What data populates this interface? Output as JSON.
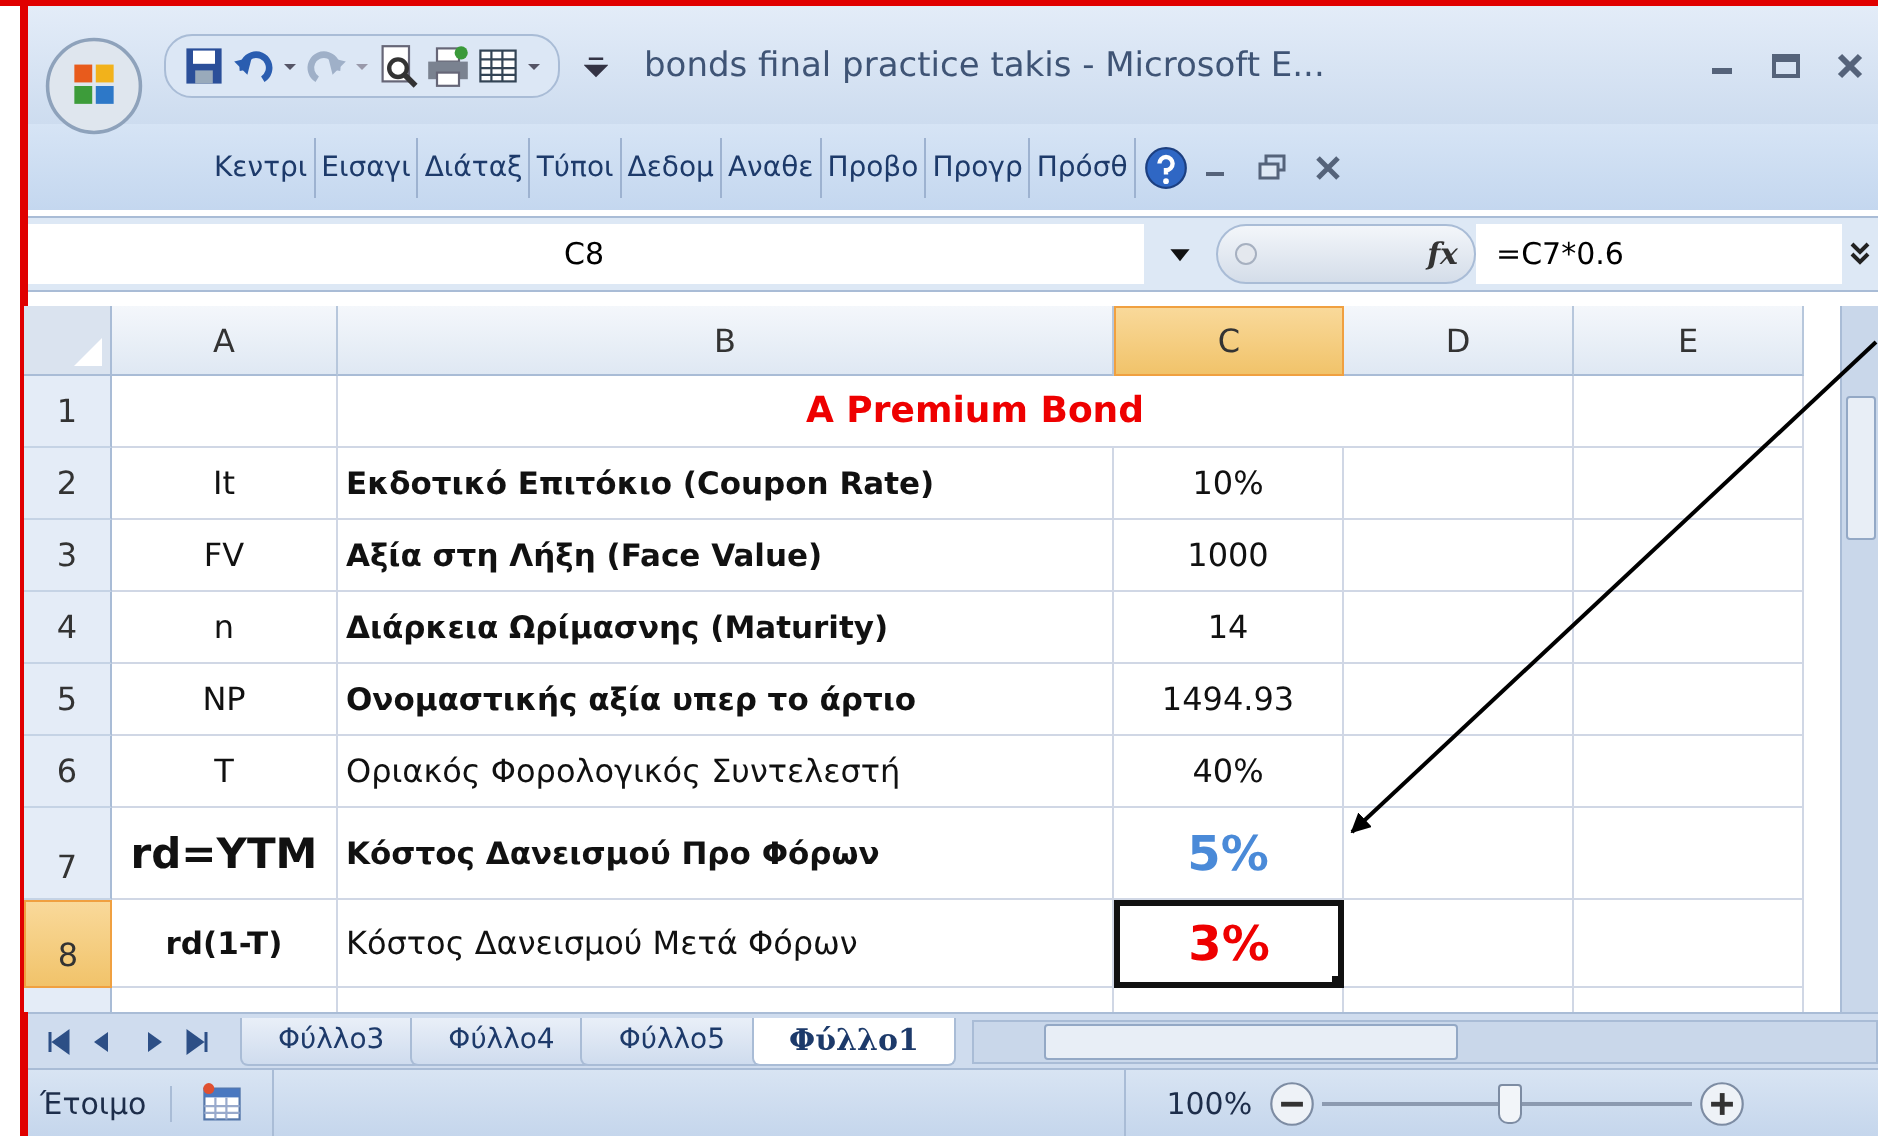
{
  "window": {
    "title": "bonds final practice takis - Microsoft E..."
  },
  "ribbon_tabs": [
    {
      "label": "Κεντρι",
      "selected": false
    },
    {
      "label": "Εισαγι",
      "selected": false
    },
    {
      "label": "Διάταξ",
      "selected": false
    },
    {
      "label": "Τύποι",
      "selected": false
    },
    {
      "label": "Δεδομ",
      "selected": false
    },
    {
      "label": "Αναθε",
      "selected": false
    },
    {
      "label": "Προβο",
      "selected": false
    },
    {
      "label": "Προγρ",
      "selected": false
    },
    {
      "label": "Πρόσθ",
      "selected": false
    }
  ],
  "formula_bar": {
    "name_box": "C8",
    "fx": "fx",
    "formula": "=C7*0.6"
  },
  "columns": [
    {
      "label": "A",
      "selected": false
    },
    {
      "label": "B",
      "selected": false
    },
    {
      "label": "C",
      "selected": true
    },
    {
      "label": "D",
      "selected": false
    },
    {
      "label": "E",
      "selected": false
    }
  ],
  "rows": [
    {
      "number": "1",
      "selected": false,
      "kind": "title",
      "title": "A Premium Bond"
    },
    {
      "number": "2",
      "selected": false,
      "kind": "data",
      "a": {
        "text": "It",
        "kind": "plain"
      },
      "b": {
        "text": "Εκδοτικό Επιτόκιο (Coupon Rate)",
        "kind": "bold"
      },
      "c": {
        "text": "10%",
        "kind": "plain",
        "active": false
      }
    },
    {
      "number": "3",
      "selected": false,
      "kind": "data",
      "a": {
        "text": "FV",
        "kind": "plain"
      },
      "b": {
        "text": " Αξία στη Λήξη (Face Value)",
        "kind": "bold"
      },
      "c": {
        "text": "1000",
        "kind": "plain",
        "active": false
      }
    },
    {
      "number": "4",
      "selected": false,
      "kind": "data",
      "a": {
        "text": "n",
        "kind": "plain"
      },
      "b": {
        "text": "Διάρκεια Ωρίμασνης (Maturity)",
        "kind": "bold"
      },
      "c": {
        "text": "14",
        "kind": "plain",
        "active": false
      }
    },
    {
      "number": "5",
      "selected": false,
      "kind": "data",
      "a": {
        "text": "NP",
        "kind": "plain"
      },
      "b": {
        "text": "Ονομαστικής αξία υπερ το άρτιο",
        "kind": "bold"
      },
      "c": {
        "text": "1494.93",
        "kind": "plain",
        "active": false
      }
    },
    {
      "number": "6",
      "selected": false,
      "kind": "data",
      "a": {
        "text": "T",
        "kind": "plain"
      },
      "b": {
        "text": "Οριακός Φορολογικός Συντελεστή",
        "kind": "plain"
      },
      "c": {
        "text": "40%",
        "kind": "plain",
        "active": false
      }
    },
    {
      "number": "7",
      "selected": false,
      "kind": "data",
      "a": {
        "text": "rd=YTM",
        "kind": "big"
      },
      "b": {
        "text": "Κόστος Δανεισμού Προ Φόρων",
        "kind": "bold"
      },
      "c": {
        "text": "5%",
        "kind": "blue",
        "active": false
      }
    },
    {
      "number": "8",
      "selected": true,
      "kind": "data",
      "a": {
        "text": "rd(1-T)",
        "kind": "bold"
      },
      "b": {
        "text": "Κόστος Δανεισμού Μετά Φόρων",
        "kind": "plain"
      },
      "c": {
        "text": "3%",
        "kind": "red",
        "active": true
      }
    }
  ],
  "sheet_tabs": [
    {
      "label": "Φύλλο3",
      "selected": false
    },
    {
      "label": "Φύλλο4",
      "selected": false
    },
    {
      "label": "Φύλλο5",
      "selected": false
    },
    {
      "label": "Φύλλο1",
      "selected": true
    }
  ],
  "status_bar": {
    "status": "Έτοιμο",
    "zoom": "100%",
    "level": 0.5
  }
}
